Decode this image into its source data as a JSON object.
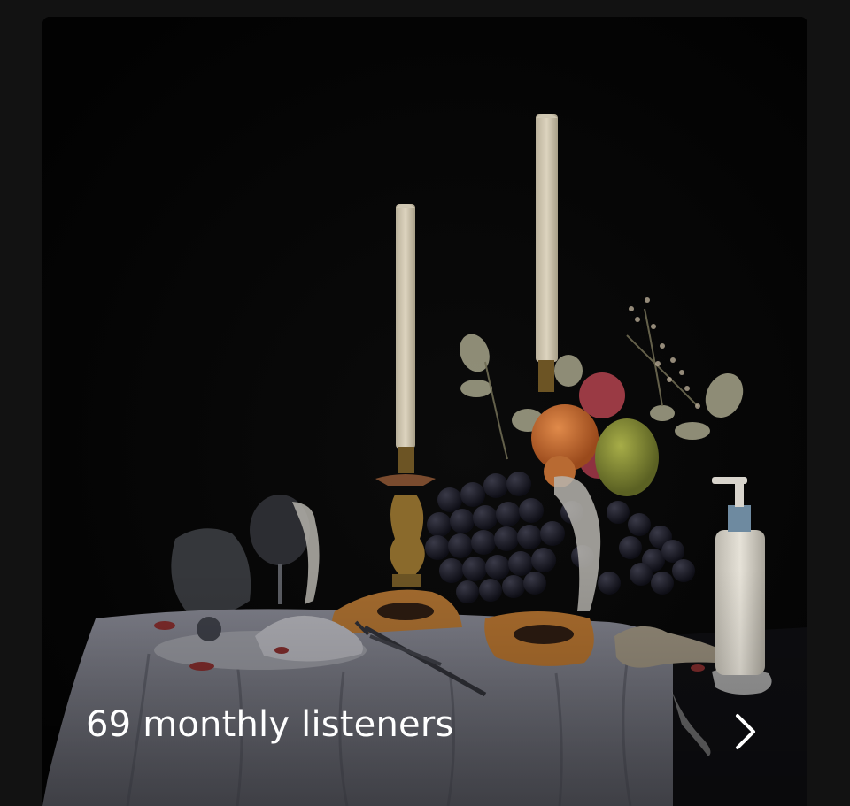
{
  "artist_card": {
    "listeners_text": "69 monthly listeners",
    "chevron_icon": "chevron-right-icon",
    "artwork_description_icon": "still-life-image"
  },
  "colors": {
    "page_background": "#121212",
    "card_background": "#000000",
    "text": "#ffffff"
  }
}
